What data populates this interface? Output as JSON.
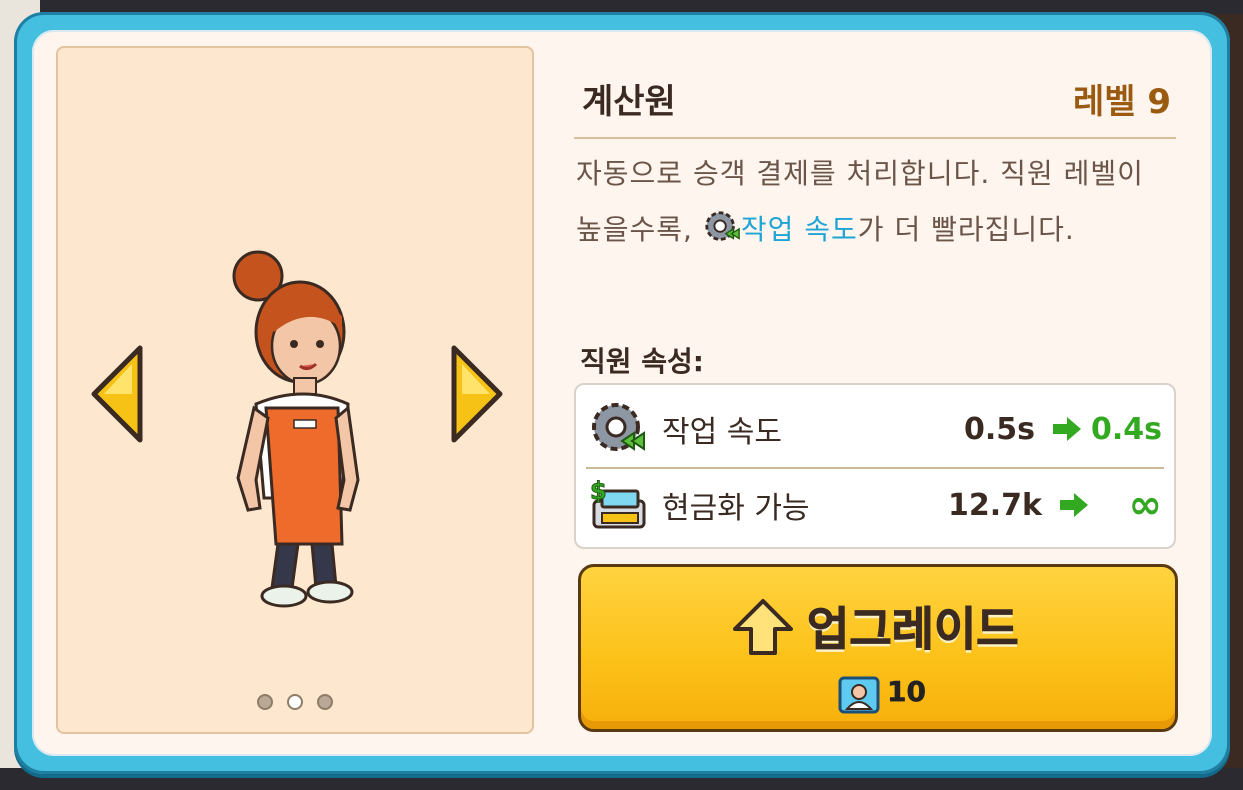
{
  "staff": {
    "name": "계산원",
    "level_label": "레벨 9"
  },
  "description": {
    "part1": "자동으로 승객 결제를 처리합니다. 직원 레벨이 높을수록, ",
    "highlight": "작업 속도",
    "part2": "가 더 빨라집니다."
  },
  "attributes": {
    "title": "직원 속성:",
    "rows": [
      {
        "icon": "gear-speed-icon",
        "label": "작업 속도",
        "from": "0.5s",
        "to": "0.4s"
      },
      {
        "icon": "cash-register-icon",
        "label": "현금화 가능",
        "from": "12.7k",
        "to": "∞"
      }
    ]
  },
  "upgrade": {
    "label": "업그레이드",
    "cost": "10",
    "cost_icon": "staff-card-icon"
  },
  "carousel": {
    "page_count": 3,
    "active_index": 1
  },
  "colors": {
    "frame": "#45bfe0",
    "panel": "#fdf5ee",
    "preview_bg": "#fde7cf",
    "level": "#9a5a10",
    "highlight": "#1fa4d6",
    "increase": "#33a821",
    "button": "#fcc21a"
  }
}
